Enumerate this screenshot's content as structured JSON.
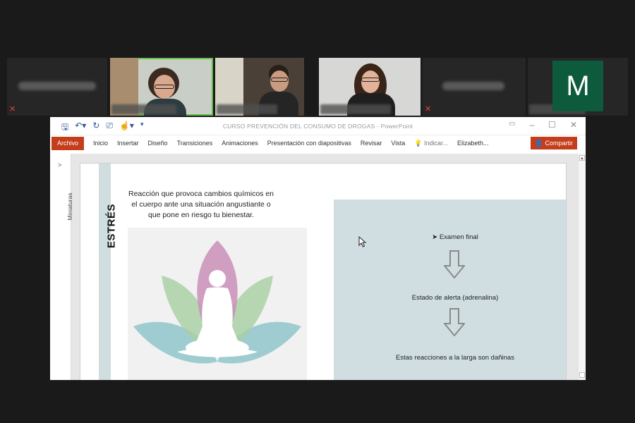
{
  "window": {
    "title": "CURSO PREVENCIÓN DEL CONSUMO DE DROGAS - PowerPoint"
  },
  "ribbon": {
    "archivo": "Archivo",
    "tabs": [
      "Inicio",
      "Insertar",
      "Diseño",
      "Transiciones",
      "Animaciones",
      "Presentación con diapositivas",
      "Revisar",
      "Vista"
    ],
    "tell_me": "Indicar...",
    "user": "Elizabeth...",
    "share": "Compartir"
  },
  "thumbnails_pane": {
    "label": "Miniaturas"
  },
  "participants": {
    "avatar_letter": "M"
  },
  "slide": {
    "vertical_title": "ESTRÉS",
    "definition": "Reacción que provoca cambios químicos en el cuerpo ante una situación angustiante o que pone en riesgo tu bienestar.",
    "steps": [
      "Examen final",
      "Estado de alerta (adrenalina)",
      "Estas reacciones a la larga son dañinas"
    ],
    "bullet_glyph": "➤"
  },
  "colors": {
    "accent": "#c43e1c",
    "panel": "#d0dee2",
    "avatar_bg": "#0d5a3d",
    "active_speaker": "#5fc24a"
  }
}
